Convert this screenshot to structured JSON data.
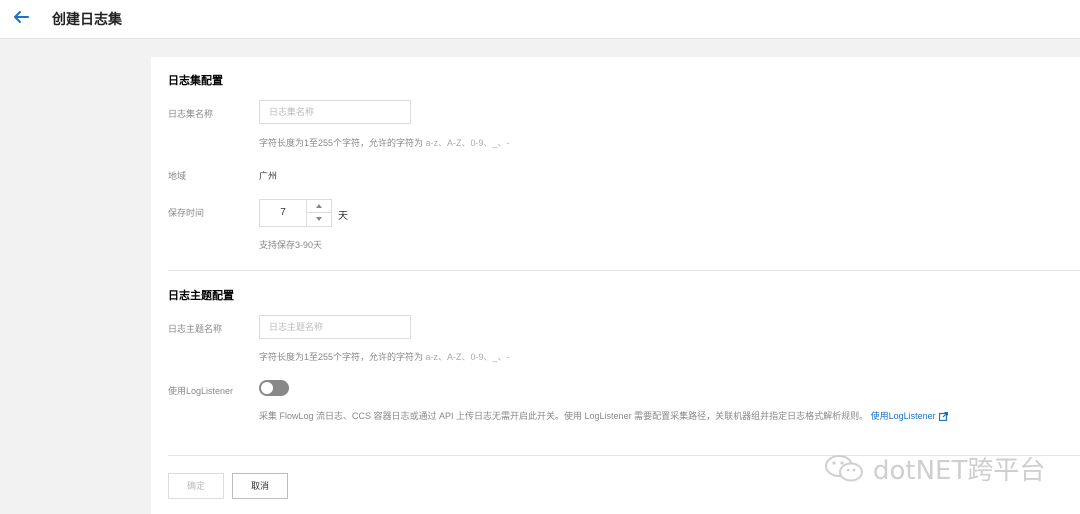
{
  "header": {
    "back_icon": "arrow-left-icon",
    "title": "创建日志集"
  },
  "logset": {
    "section_title": "日志集配置",
    "name_label": "日志集名称",
    "name_placeholder": "日志集名称",
    "name_value": "",
    "name_hint_main": "字符长度为1至255个字符，允许的字符为 ",
    "name_hint_chars": "a-z、A-Z、0-9、_、-",
    "region_label": "地域",
    "region_value": "广州",
    "retention_label": "保存时间",
    "retention_value": "7",
    "retention_unit": "天",
    "retention_hint": "支持保存3-90天"
  },
  "topic": {
    "section_title": "日志主题配置",
    "name_label": "日志主题名称",
    "name_placeholder": "日志主题名称",
    "name_value": "",
    "name_hint_main": "字符长度为1至255个字符，允许的字符为 ",
    "name_hint_chars": "a-z、A-Z、0-9、_、-",
    "loglistener_label": "使用LogListener",
    "loglistener_enabled": false,
    "loglistener_desc": "采集 FlowLog 流日志、CCS 容器日志或通过 API 上传日志无需开启此开关。使用 LogListener 需要配置采集路径，关联机器组并指定日志格式解析规则。",
    "loglistener_link": "使用LogListener",
    "link_icon": "external-link-icon"
  },
  "actions": {
    "confirm_label": "确定",
    "cancel_label": "取消"
  },
  "watermark": {
    "text": "dotNET跨平台",
    "icon": "wechat-icon"
  },
  "colors": {
    "accent": "#1a73c9",
    "toggle_off": "#888888"
  }
}
